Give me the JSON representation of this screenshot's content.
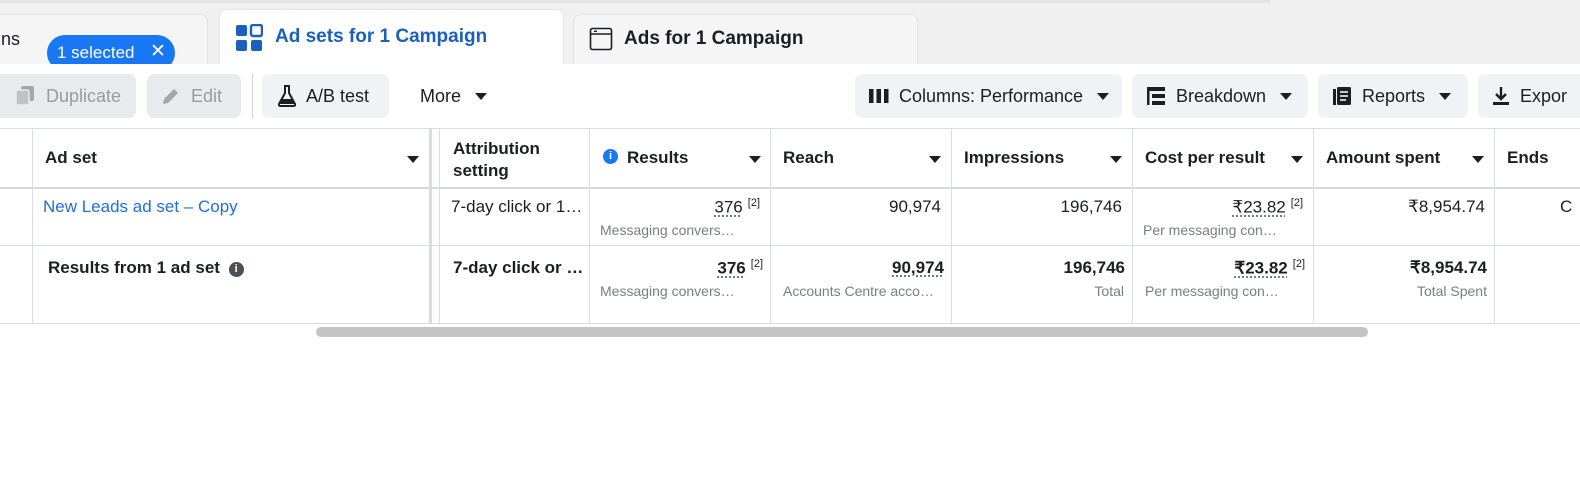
{
  "tabs": {
    "campaigns": {
      "label": "ns",
      "selected_pill": "1 selected",
      "clear": "✕"
    },
    "adsets": {
      "label": "Ad sets for 1 Campaign"
    },
    "ads": {
      "label": "Ads for 1 Campaign"
    }
  },
  "toolbar": {
    "duplicate": "Duplicate",
    "edit": "Edit",
    "ab_test": "A/B test",
    "more": "More",
    "columns": "Columns: Performance",
    "breakdown": "Breakdown",
    "reports": "Reports",
    "export": "Expor"
  },
  "table": {
    "headers": {
      "adset": "Ad set",
      "attribution_1": "Attribution",
      "attribution_2": "setting",
      "results": "Results",
      "reach": "Reach",
      "impressions": "Impressions",
      "cost_per_result": "Cost per result",
      "amount_spent": "Amount spent",
      "ends": "Ends"
    },
    "row": {
      "left_edge": ")",
      "adset": "New Leads ad set – Copy",
      "attribution": "7-day click or 1…",
      "results": "376",
      "results_ref": "[2]",
      "results_sub": "Messaging convers…",
      "reach": "90,974",
      "impressions": "196,746",
      "cost": "₹23.82",
      "cost_ref": "[2]",
      "cost_sub": "Per messaging con…",
      "spent": "₹8,954.74",
      "ends": "C"
    },
    "summary": {
      "label": "Results from 1 ad set",
      "attribution": "7-day click or …",
      "results": "376",
      "results_ref": "[2]",
      "results_sub": "Messaging convers…",
      "reach": "90,974",
      "reach_sub": "Accounts Centre acco…",
      "impressions": "196,746",
      "impressions_sub": "Total",
      "cost": "₹23.82",
      "cost_ref": "[2]",
      "cost_sub": "Per messaging con…",
      "spent": "₹8,954.74",
      "spent_sub": "Total Spent"
    }
  },
  "colors": {
    "accent": "#1877f2",
    "link": "#216fdb",
    "active_tab_text": "#1b5fbf"
  }
}
